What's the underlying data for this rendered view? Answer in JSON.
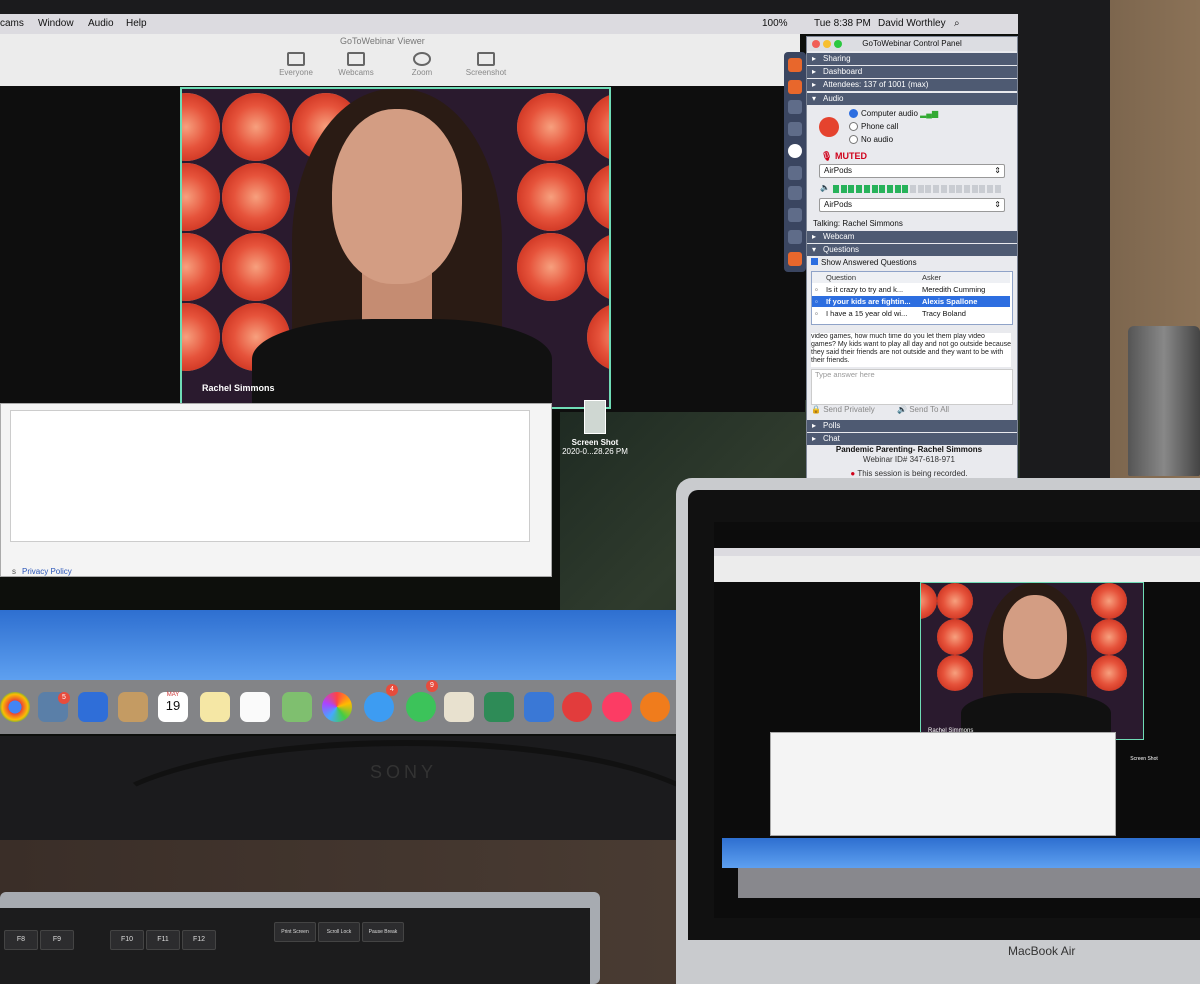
{
  "mac_menubar": {
    "items": [
      "cams",
      "Window",
      "Audio",
      "Help"
    ],
    "battery": "100%",
    "clock": "Tue 8:38 PM",
    "user": "David Worthley"
  },
  "viewer": {
    "title": "GoToWebinar Viewer",
    "toolbar": [
      {
        "label": "Everyone",
        "icon": "person-icon"
      },
      {
        "label": "Webcams",
        "icon": "camera-icon"
      },
      {
        "label": "Zoom",
        "icon": "zoom-icon"
      },
      {
        "label": "Screenshot",
        "icon": "screenshot-icon"
      }
    ],
    "webcam_name": "Rachel Simmons"
  },
  "app_window": {
    "privacy_link": "Privacy Policy",
    "prefix": "s"
  },
  "desktop_file": {
    "name": "Screen Shot",
    "date": "2020-0...28.26 PM"
  },
  "dock": {
    "badges": [
      "5",
      "4",
      "9"
    ],
    "calendar_month": "MAY",
    "calendar_day": "19"
  },
  "control_panel": {
    "title": "GoToWebinar Control Panel",
    "sections": {
      "sharing": "Sharing",
      "dashboard": "Dashboard",
      "attendees": "Attendees: 137 of 1001 (max)",
      "audio": "Audio",
      "webcam": "Webcam",
      "questions": "Questions",
      "polls": "Polls",
      "chat": "Chat"
    },
    "audio": {
      "options": [
        "Computer audio",
        "Phone call",
        "No audio"
      ],
      "selected": 0,
      "muted_label": "MUTED",
      "mic_device": "AirPods",
      "speaker_device": "AirPods",
      "speaker_level": 0.45,
      "talking": "Talking:  Rachel Simmons"
    },
    "questions": {
      "show_answered": "Show Answered Questions",
      "columns": [
        "Question",
        "Asker"
      ],
      "rows": [
        {
          "question": "Is it crazy to try and k...",
          "asker": "Meredith Cumming",
          "selected": false
        },
        {
          "question": "If your kids are fightin...",
          "asker": "Alexis Spallone",
          "selected": true
        },
        {
          "question": "I have a 15 year old wi...",
          "asker": "Tracy Boland",
          "selected": false
        }
      ],
      "detail": "video games, how much time do you let them play video games?  My kids want to play all day and not go outside because they said their friends are not outside and they want to be with their friends.",
      "answer_placeholder": "Type answer here",
      "send_privately": "Send Privately",
      "send_to_all": "Send To All"
    },
    "footer": {
      "webinar_title": "Pandemic Parenting- Rachel Simmons",
      "webinar_id": "Webinar ID# 347-618-971",
      "recording": "This session is being recorded."
    }
  },
  "laptop": {
    "brand": "MacBook Air",
    "webcam_name": "Rachel Simmons",
    "desktop_file": "Screen Shot"
  },
  "monitor_brand": "SONY",
  "keyboard_keys": [
    "F8",
    "F9",
    "F10",
    "F11",
    "F12",
    "Print Screen",
    "Scroll Lock",
    "Pause Break"
  ],
  "colors": {
    "panel_header": "#4e5a72",
    "muted": "#d0021b",
    "webcam_border": "#6fdcb6",
    "selected_row": "#2d6ee0"
  }
}
